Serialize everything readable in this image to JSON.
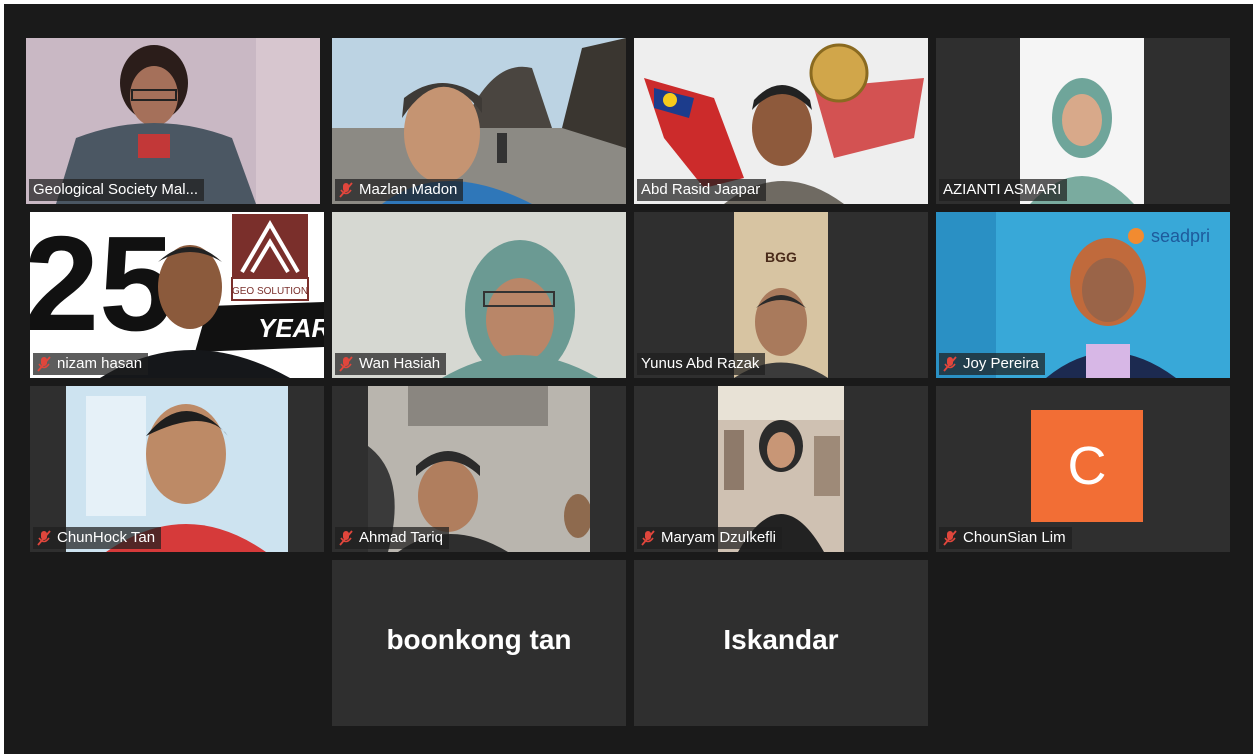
{
  "participants": [
    {
      "name": "Geological Society Mal...",
      "muted": false
    },
    {
      "name": "Mazlan Madon",
      "muted": true
    },
    {
      "name": "Abd Rasid Jaapar",
      "muted": false
    },
    {
      "name": "AZIANTI ASMARI",
      "muted": false
    },
    {
      "name": "nizam hasan",
      "muted": true
    },
    {
      "name": "Wan Hasiah",
      "muted": true
    },
    {
      "name": "Yunus Abd Razak",
      "muted": false
    },
    {
      "name": "Joy Pereira",
      "muted": true
    },
    {
      "name": "ChunHock Tan",
      "muted": true
    },
    {
      "name": "Ahmad Tariq",
      "muted": true
    },
    {
      "name": "Maryam Dzulkefli",
      "muted": true
    },
    {
      "name": "ChounSian Lim",
      "muted": true,
      "avatar_letter": "C"
    },
    {
      "name": "boonkong tan"
    },
    {
      "name": "Iskandar"
    }
  ],
  "backgrounds": {
    "logo_25": "25",
    "geo_solution": "GEO SOLUTION",
    "years": "YEARS",
    "bgg": "BGG",
    "seadpri": "seadpri"
  },
  "colors": {
    "speaker_border": "#d8e878",
    "muted_icon": "#e0463c",
    "avatar_bg": "#f26e35",
    "tile_bg": "#2f2f2f",
    "stage_bg": "#1a1a1a"
  }
}
